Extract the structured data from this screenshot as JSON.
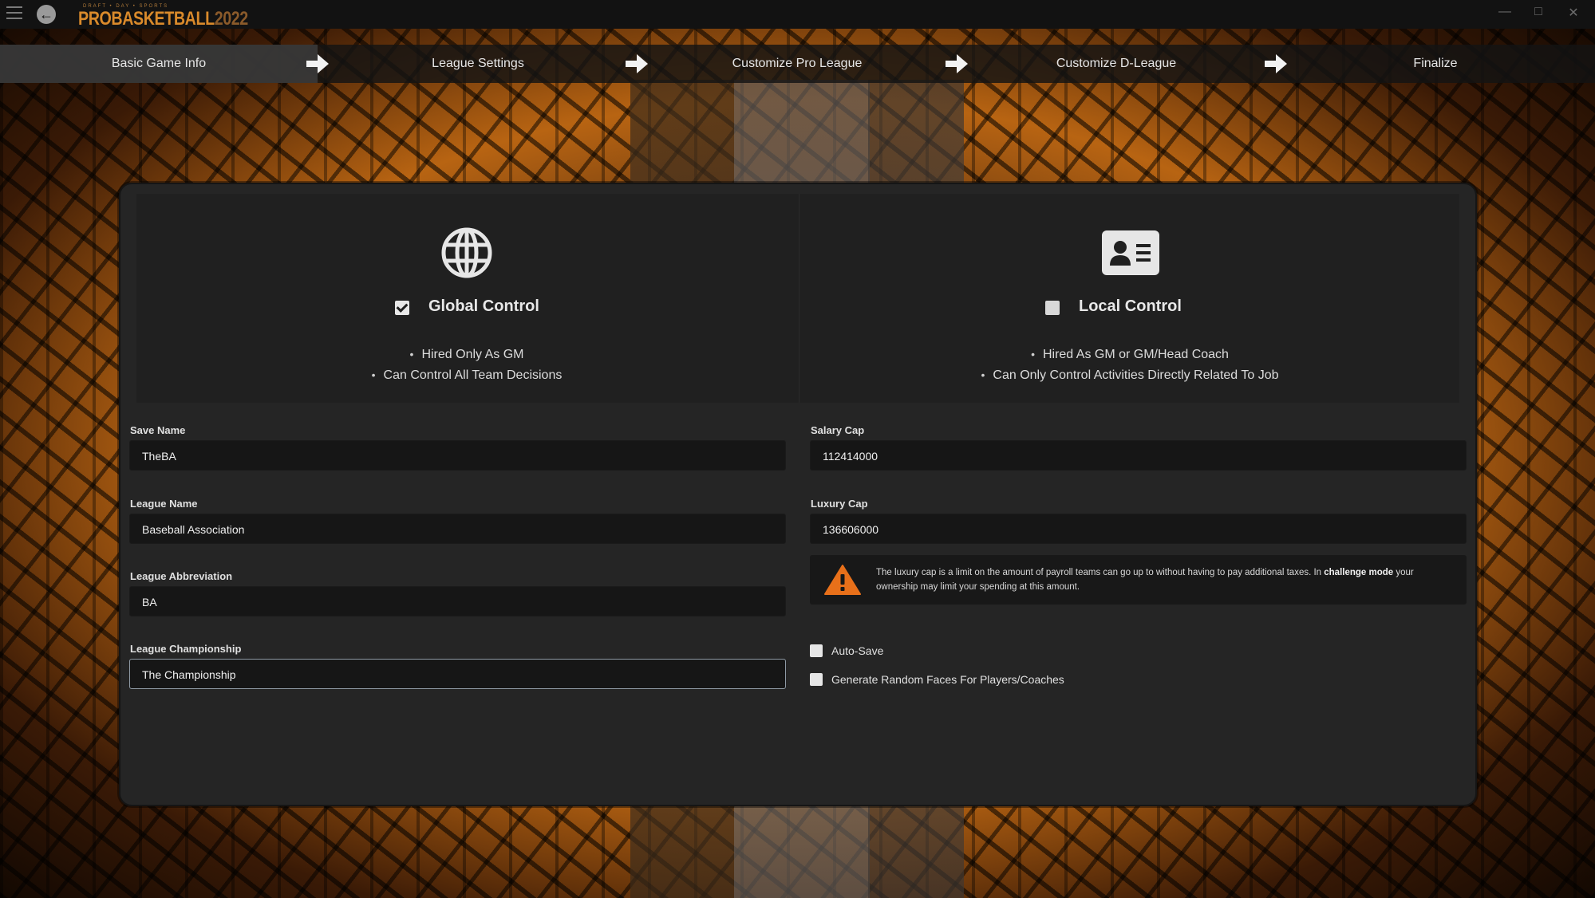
{
  "app": {
    "logo_top": "DRAFT • DAY • SPORTS",
    "logo_pro": "PRO",
    "logo_basketball": "BASKETBALL",
    "logo_year": "2022"
  },
  "steps": [
    {
      "label": "Basic Game Info",
      "active": true
    },
    {
      "label": "League Settings",
      "active": false
    },
    {
      "label": "Customize Pro League",
      "active": false
    },
    {
      "label": "Customize D-League",
      "active": false
    },
    {
      "label": "Finalize",
      "active": false
    }
  ],
  "modes": {
    "global": {
      "title": "Global Control",
      "checked": true,
      "icon": "globe-icon",
      "bullets": [
        "Hired Only As GM",
        "Can Control All Team Decisions"
      ]
    },
    "local": {
      "title": "Local Control",
      "checked": false,
      "icon": "id-card-icon",
      "bullets": [
        "Hired As GM or GM/Head Coach",
        "Can Only Control Activities Directly Related To Job"
      ]
    }
  },
  "form": {
    "save_name": {
      "label": "Save Name",
      "value": "TheBA"
    },
    "league_name": {
      "label": "League Name",
      "value": "Baseball Association"
    },
    "league_abbreviation": {
      "label": "League Abbreviation",
      "value": "BA"
    },
    "league_championship": {
      "label": "League Championship",
      "value": "The Championship"
    },
    "salary_cap": {
      "label": "Salary Cap",
      "value": "112414000"
    },
    "luxury_cap": {
      "label": "Luxury Cap",
      "value": "136606000"
    }
  },
  "warning": {
    "text_before": "The luxury cap is a limit on the amount of payroll teams can go up to without having to pay additional taxes. In ",
    "text_bold": "challenge mode",
    "text_after": " your ownership may limit your spending at this amount."
  },
  "options": {
    "auto_save": {
      "label": "Auto-Save",
      "checked": false
    },
    "random_faces": {
      "label": "Generate Random Faces For Players/Coaches",
      "checked": false
    }
  },
  "colors": {
    "accent": "#d98a2b",
    "warning": "#e8701a",
    "panel": "#252525"
  }
}
